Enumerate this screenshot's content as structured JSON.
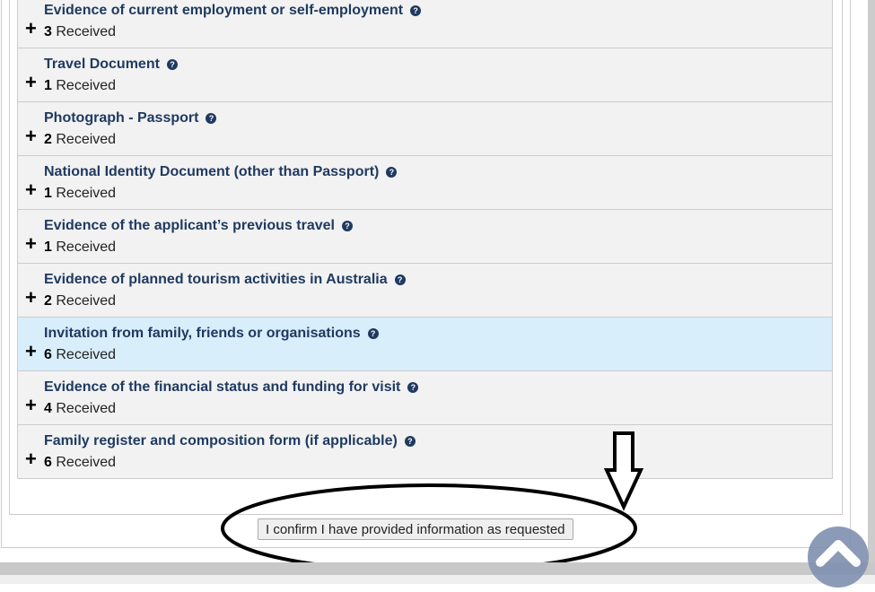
{
  "documents": [
    {
      "title": "Evidence of current employment or self-employment",
      "count": "3",
      "status": "Received"
    },
    {
      "title": "Travel Document",
      "count": "1",
      "status": "Received"
    },
    {
      "title": "Photograph - Passport",
      "count": "2",
      "status": "Received"
    },
    {
      "title": "National Identity Document (other than Passport)",
      "count": "1",
      "status": "Received"
    },
    {
      "title": "Evidence of the applicant’s previous travel",
      "count": "1",
      "status": "Received"
    },
    {
      "title": "Evidence of planned tourism activities in Australia",
      "count": "2",
      "status": "Received"
    },
    {
      "title": "Invitation from family, friends or organisations",
      "count": "6",
      "status": "Received",
      "highlighted": true
    },
    {
      "title": "Evidence of the financial status and funding for visit",
      "count": "4",
      "status": "Received"
    },
    {
      "title": "Family register and composition form (if applicable)",
      "count": "6",
      "status": "Received"
    }
  ],
  "icons": {
    "expand": "plus-icon",
    "help": "help-question-icon",
    "back_to_top": "chevron-up-icon"
  },
  "confirm_button": "I confirm I have provided information as requested",
  "colors": {
    "title": "#1f3a60",
    "highlight": "#d9eefb",
    "row": "#f2f2f2"
  }
}
